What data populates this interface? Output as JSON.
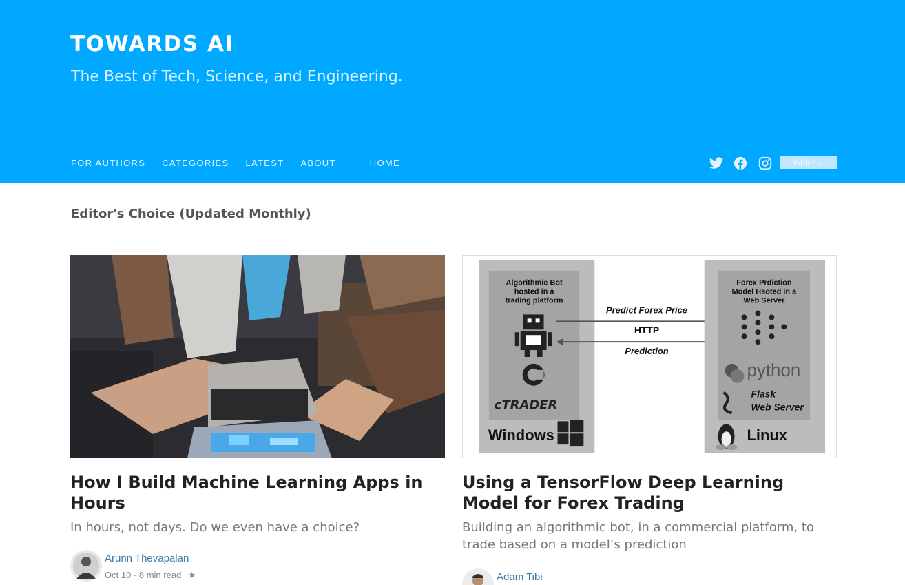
{
  "brand": {
    "logo_text": "TOWARDS AI",
    "tagline": "The Best of Tech, Science, and Engineering."
  },
  "nav": {
    "items": [
      "FOR AUTHORS",
      "CATEGORIES",
      "LATEST",
      "ABOUT"
    ],
    "home": "HOME"
  },
  "social": {
    "icons": [
      "twitter-icon",
      "facebook-icon",
      "instagram-icon"
    ],
    "writer_label": "Writer"
  },
  "colors": {
    "header_bg": "#00a8ff",
    "link": "#3a7aa6"
  },
  "section": {
    "title": "Editor's Choice (Updated Monthly)"
  },
  "posts": [
    {
      "title": "How I Build Machine Learning Apps in Hours",
      "subtitle": "In hours, not days. Do we even have a choice?",
      "author": "Arunn Thevapalan",
      "date": "Oct 10",
      "read_time": "8 min read",
      "starred": "★"
    },
    {
      "title": "Using a TensorFlow Deep Learning Model for Forex Trading",
      "subtitle": "Building an algorithmic bot, in a commercial platform, to trade based on a model’s prediction",
      "author": "Adam Tibi",
      "diagram": {
        "left_box_title": "Algorithmic Bot hosted in a trading platform",
        "right_box_title": "Forex Prdiction Model Hsoted in a Web Server",
        "arrow_top": "Predict Forex Price",
        "arrow_mid": "HTTP",
        "arrow_bottom": "Prediction",
        "left_logo": "cTRADER",
        "left_os": "Windows",
        "right_lang": "python",
        "right_server_1": "Flask",
        "right_server_2": "Web Server",
        "right_os": "Linux"
      }
    }
  ]
}
